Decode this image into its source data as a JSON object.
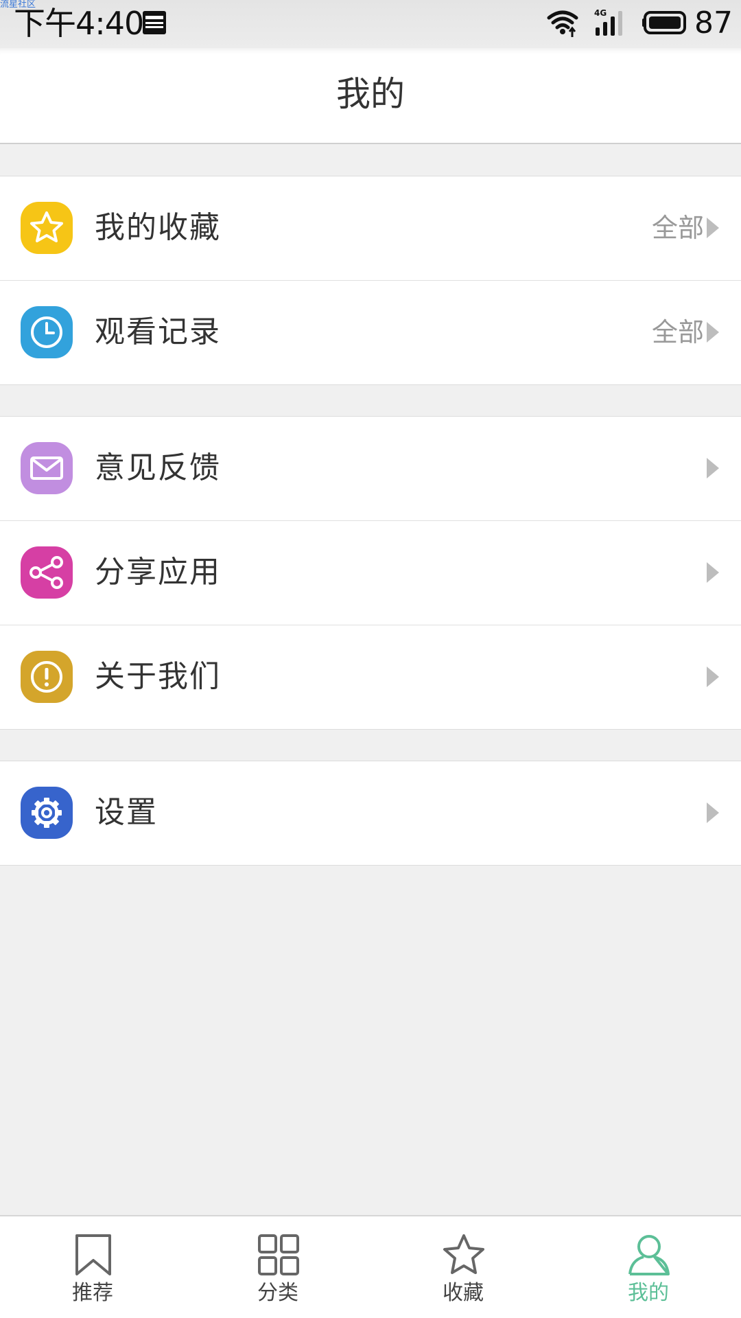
{
  "status_bar": {
    "watermark": "流星社区",
    "time": "下午4:40",
    "battery_level": "87",
    "icons": [
      "news-icon",
      "wifi-icon",
      "signal-4g-icon",
      "battery-icon"
    ]
  },
  "header": {
    "title": "我的"
  },
  "groups": [
    {
      "rows": [
        {
          "label": "我的收藏",
          "right_text": "全部",
          "icon": "star-icon",
          "icon_color": "#f6c516"
        },
        {
          "label": "观看记录",
          "right_text": "全部",
          "icon": "clock-icon",
          "icon_color": "#32a2dc"
        }
      ]
    },
    {
      "rows": [
        {
          "label": "意见反馈",
          "icon": "mail-icon",
          "icon_color": "#c18ee0"
        },
        {
          "label": "分享应用",
          "icon": "share-icon",
          "icon_color": "#d63fa4"
        },
        {
          "label": "关于我们",
          "icon": "info-icon",
          "icon_color": "#d4a52b"
        }
      ]
    },
    {
      "rows": [
        {
          "label": "设置",
          "icon": "gear-icon",
          "icon_color": "#3764cc"
        }
      ]
    }
  ],
  "tabbar": {
    "tabs": [
      {
        "label": "推荐",
        "icon": "bookmark-icon",
        "active": false
      },
      {
        "label": "分类",
        "icon": "grid-icon",
        "active": false
      },
      {
        "label": "收藏",
        "icon": "star-outline-icon",
        "active": false
      },
      {
        "label": "我的",
        "icon": "person-icon",
        "active": true
      }
    ],
    "active_color": "#5cbf97"
  }
}
